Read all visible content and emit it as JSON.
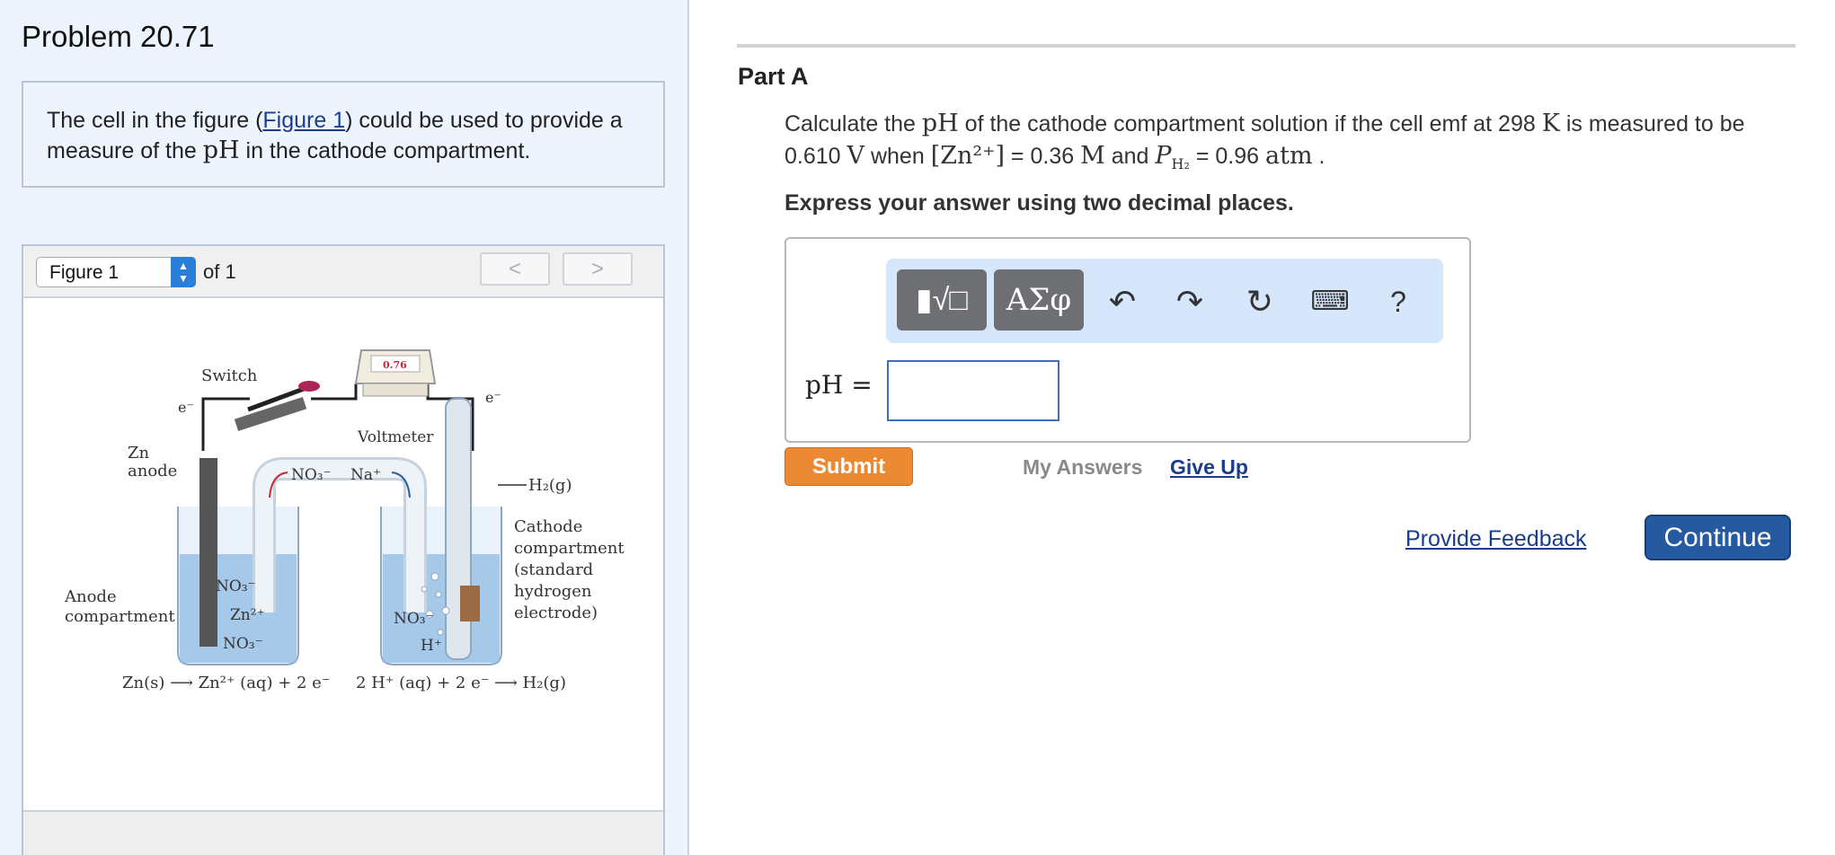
{
  "problem": {
    "title": "Problem 20.71",
    "intro_pre": "The cell in the figure (",
    "intro_link": "Figure 1",
    "intro_mid": ") could be used to provide a measure of the ",
    "intro_ph": "pH",
    "intro_post": " in the cathode compartment."
  },
  "figure": {
    "selected": "Figure 1",
    "of_label": "of 1",
    "prev": "<",
    "next": ">",
    "labels": {
      "switch": "Switch",
      "voltmeter": "Voltmeter",
      "display": "0.76",
      "e_left": "e⁻",
      "e_right": "e⁻",
      "zn_anode_1": "Zn",
      "zn_anode_2": "anode",
      "no3_bridge": "NO₃⁻",
      "na_bridge": "Na⁺",
      "h2g": "H₂(g)",
      "cathode_1": "Cathode",
      "cathode_2": "compartment",
      "cathode_3": "(standard",
      "cathode_4": "hydrogen",
      "cathode_5": "electrode)",
      "anode_comp_1": "Anode",
      "anode_comp_2": "compartment",
      "no3_a1": "NO₃⁻",
      "zn2": "Zn²⁺",
      "no3_a2": "NO₃⁻",
      "no3_c": "NO₃⁻",
      "h_plus": "H⁺",
      "eq_anode": "Zn(s) ⟶ Zn²⁺ (aq) + 2 e⁻",
      "eq_cathode": "2 H⁺ (aq) + 2 e⁻ ⟶ H₂(g)"
    }
  },
  "part": {
    "label": "Part A",
    "q_1": "Calculate the ",
    "q_ph": "pH",
    "q_2": " of the cathode compartment solution if the cell emf at 298 ",
    "q_k": "K",
    "q_3": " is measured to be 0.610 ",
    "q_v": "V",
    "q_4": " when ",
    "q_zn": "[Zn²⁺]",
    "q_5": " = 0.36 ",
    "q_m": "M",
    "q_6": " and ",
    "q_p": "P",
    "q_p_sub": "H₂",
    "q_7": " = 0.96 ",
    "q_atm": "atm",
    "q_8": " .",
    "instructions": "Express your answer using two decimal places."
  },
  "answer": {
    "label": "pH =",
    "value": "",
    "toolbar": {
      "templates": "▮√□",
      "symbols": "ΑΣφ",
      "undo": "↶",
      "redo": "↷",
      "reset": "↻",
      "keyboard": "⌨",
      "help": "?"
    }
  },
  "actions": {
    "submit": "Submit",
    "my_answers": "My Answers",
    "give_up": "Give Up",
    "feedback": "Provide Feedback",
    "continue": "Continue"
  }
}
